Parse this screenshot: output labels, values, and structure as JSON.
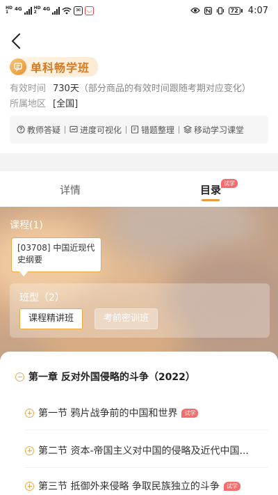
{
  "status_bar": {
    "hd1": "HD",
    "net1": "4G",
    "hd2": "HD",
    "net2": "4G",
    "battery": "72",
    "time": "4:07"
  },
  "class_badge": {
    "label": "单科畅学班"
  },
  "validity": {
    "label": "有效时间",
    "value": "730天",
    "note": "（部分商品的有效时间跟随考期对应变化）"
  },
  "region": {
    "label": "所属地区",
    "value": "[全国]"
  },
  "features": [
    "教师答疑",
    "进度可视化",
    "错题整理",
    "移动学习课堂"
  ],
  "tabs": {
    "details": "详情",
    "catalog": "目录",
    "catalog_badge": "试学"
  },
  "course": {
    "title": "课程(1)",
    "card_text": "[03708] 中国近现代史纲要"
  },
  "class_type": {
    "title": "班型（2）",
    "options": [
      "课程精讲班",
      "考前密训班"
    ]
  },
  "chapter": {
    "title": "第一章 反对外国侵略的斗争（2022）"
  },
  "sections": [
    {
      "title": "第一节 鸦片战争前的中国和世界",
      "badge": "试学"
    },
    {
      "title": "第二节 资本-帝国主义对中国的侵略及近代中国...",
      "badge": ""
    },
    {
      "title": "第三节 抵御外来侵略 争取民族独立的斗争",
      "badge": "试学"
    }
  ],
  "colors": {
    "accent": "#f0a940",
    "trial_badge": "#f56c6c",
    "badge_text": "#d8791f"
  }
}
